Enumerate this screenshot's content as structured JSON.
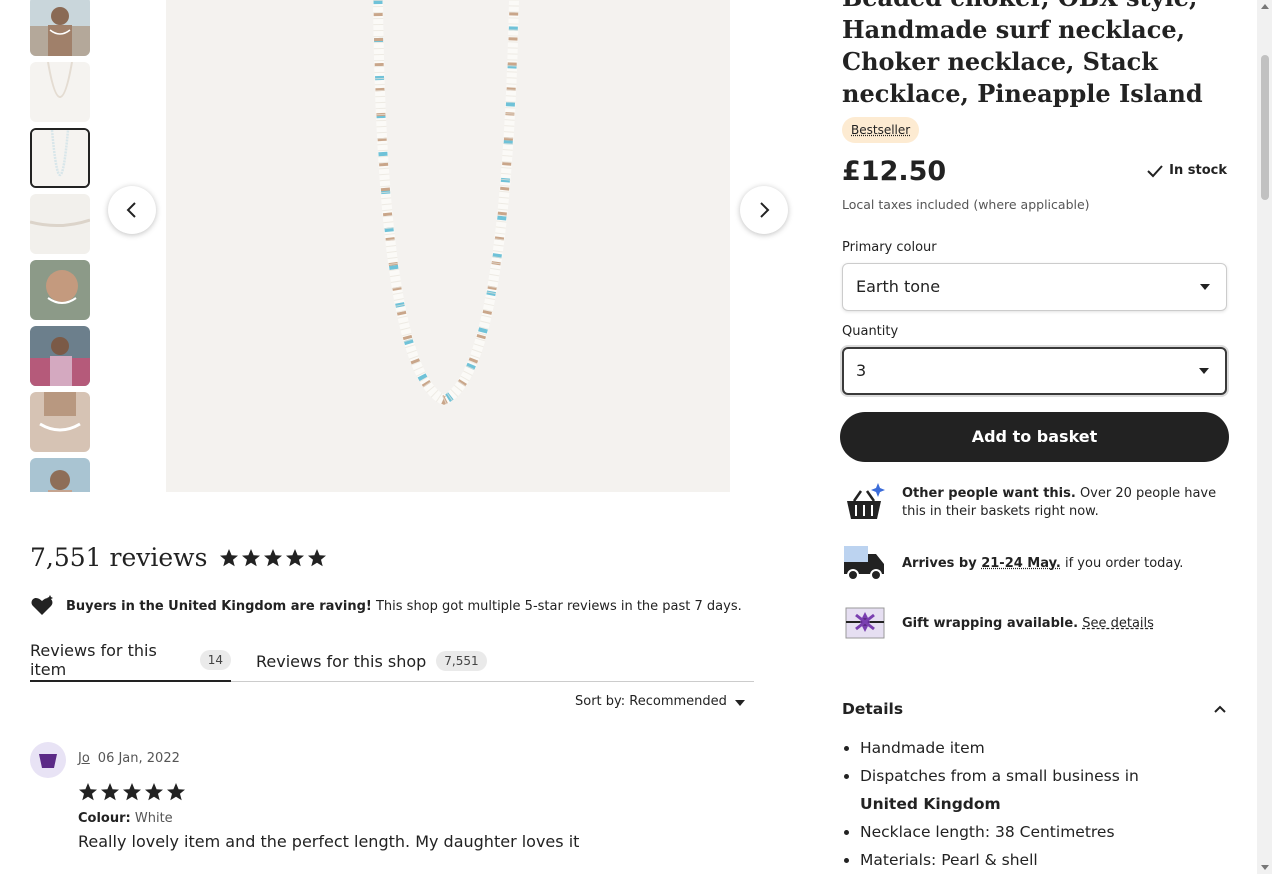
{
  "gallery": {
    "thumbnails": [
      {
        "label": "Photo 1",
        "selected": false
      },
      {
        "label": "Photo 2",
        "selected": false
      },
      {
        "label": "Photo 3",
        "selected": true
      },
      {
        "label": "Photo 4",
        "selected": false
      },
      {
        "label": "Photo 5",
        "selected": false
      },
      {
        "label": "Photo 6",
        "selected": false
      },
      {
        "label": "Photo 7",
        "selected": false
      },
      {
        "label": "Photo 8",
        "selected": false
      }
    ],
    "prev_icon": "chevron-left-icon",
    "next_icon": "chevron-right-icon"
  },
  "listing": {
    "title": "Beaded choker, OBX style, Handmade surf necklace, Choker necklace, Stack necklace, Pineapple Island",
    "badge": "Bestseller",
    "price": "£12.50",
    "stock": "In stock",
    "taxes": "Local taxes included (where applicable)",
    "primary_colour_label": "Primary colour",
    "primary_colour_value": "Earth tone",
    "quantity_label": "Quantity",
    "quantity_value": "3",
    "add_to_basket": "Add to basket"
  },
  "info": {
    "demand_bold": "Other people want this.",
    "demand_text": " Over 20 people have this in their baskets right now.",
    "arrives_prefix": "Arrives by ",
    "arrives_date": "21-24 May.",
    "arrives_suffix": " if you order today.",
    "gift_bold": "Gift wrapping available.",
    "gift_link": "See details"
  },
  "details": {
    "heading": "Details",
    "item1": "Handmade item",
    "item2_prefix": "Dispatches from a small business in ",
    "item2_bold": "United Kingdom",
    "item3": "Necklace length: 38 Centimetres",
    "item4": "Materials: Pearl & shell"
  },
  "reviews": {
    "count_label": "7,551 reviews",
    "rating": 5,
    "raving_bold": "Buyers in the United Kingdom are raving!",
    "raving_text": " This shop got multiple 5-star reviews in the past 7 days.",
    "tab_item_label": "Reviews for this item",
    "tab_item_count": "14",
    "tab_shop_label": "Reviews for this shop",
    "tab_shop_count": "7,551",
    "sort_label": "Sort by: Recommended",
    "review": {
      "name": "Jo",
      "date": "06 Jan, 2022",
      "rating": 5,
      "variant_label": "Colour:",
      "variant_value": "White",
      "text": "Really lovely item and the perfect length. My daughter loves it"
    }
  },
  "colors": {
    "badge_bg": "#fdebd2",
    "button_bg": "#222222",
    "avatar_bg": "#e8e3f5",
    "accent_purple": "#5b2a86"
  }
}
